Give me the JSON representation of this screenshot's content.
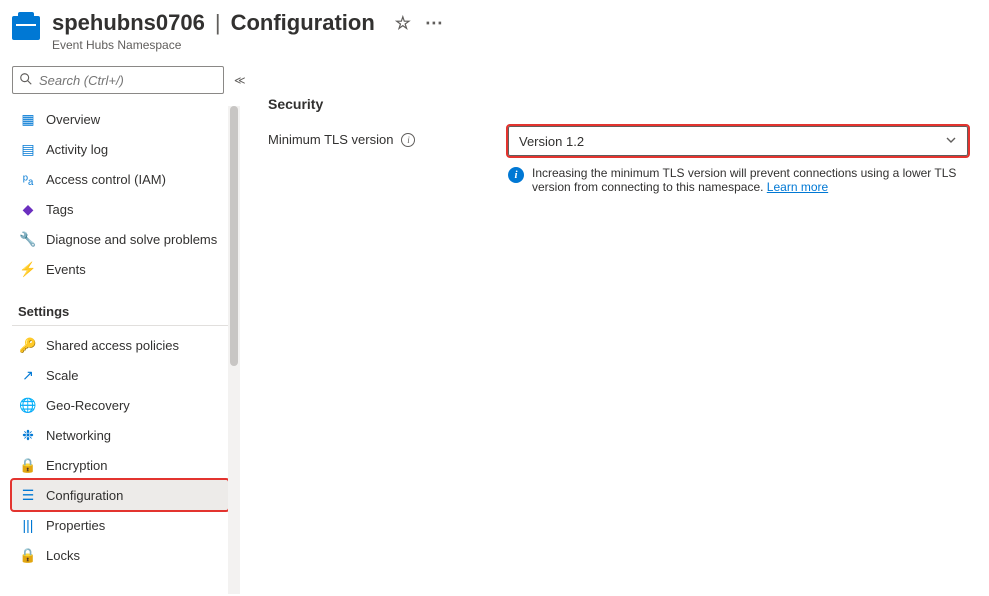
{
  "header": {
    "resource_name": "spehubns0706",
    "page_name": "Configuration",
    "subtitle": "Event Hubs Namespace"
  },
  "search": {
    "placeholder": "Search (Ctrl+/)"
  },
  "nav_top": [
    {
      "icon": "overview-icon",
      "glyph": "▦",
      "color": "#0078d4",
      "label": "Overview"
    },
    {
      "icon": "log-icon",
      "glyph": "▤",
      "color": "#0078d4",
      "label": "Activity log"
    },
    {
      "icon": "iam-icon",
      "glyph": "ᵖₐ",
      "color": "#0078d4",
      "label": "Access control (IAM)"
    },
    {
      "icon": "tag-icon",
      "glyph": "◆",
      "color": "#6b2fbf",
      "label": "Tags"
    },
    {
      "icon": "diagnose-icon",
      "glyph": "🔧",
      "color": "#323130",
      "label": "Diagnose and solve problems"
    },
    {
      "icon": "events-icon",
      "glyph": "⚡",
      "color": "#ffb900",
      "label": "Events"
    }
  ],
  "nav_section_title": "Settings",
  "nav_settings": [
    {
      "icon": "key-icon",
      "glyph": "🔑",
      "color": "#ffb900",
      "label": "Shared access policies"
    },
    {
      "icon": "scale-icon",
      "glyph": "↗",
      "color": "#0078d4",
      "label": "Scale"
    },
    {
      "icon": "geo-icon",
      "glyph": "🌐",
      "color": "#0078d4",
      "label": "Geo-Recovery"
    },
    {
      "icon": "network-icon",
      "glyph": "❉",
      "color": "#0078d4",
      "label": "Networking"
    },
    {
      "icon": "lock-icon",
      "glyph": "🔒",
      "color": "#0078d4",
      "label": "Encryption"
    },
    {
      "icon": "config-icon",
      "glyph": "☰",
      "color": "#0078d4",
      "label": "Configuration",
      "selected": true
    },
    {
      "icon": "props-icon",
      "glyph": "|||",
      "color": "#0078d4",
      "label": "Properties"
    },
    {
      "icon": "locks-icon",
      "glyph": "🔒",
      "color": "#0078d4",
      "label": "Locks"
    }
  ],
  "main": {
    "section_title": "Security",
    "tls_label": "Minimum TLS version",
    "tls_value": "Version 1.2",
    "hint_text": "Increasing the minimum TLS version will prevent connections using a lower TLS version from connecting to this namespace. ",
    "learn_more": "Learn more"
  }
}
